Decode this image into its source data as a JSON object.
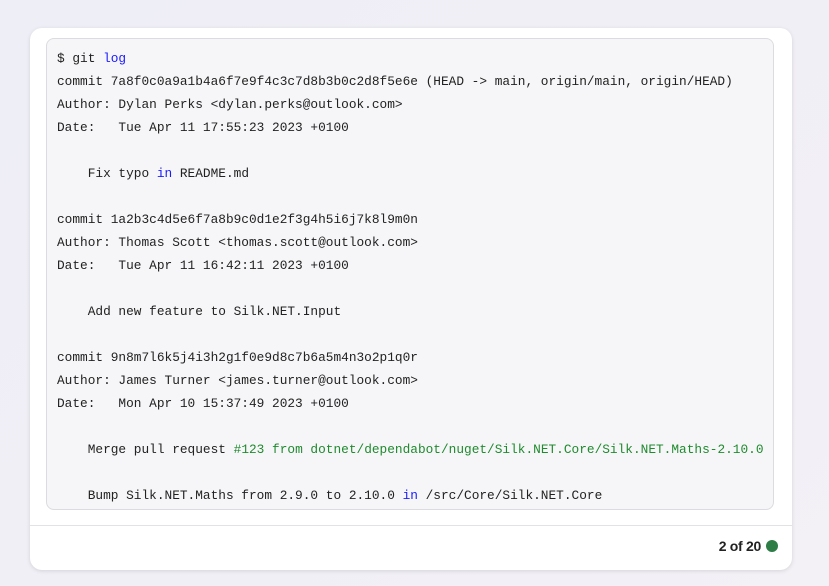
{
  "terminal": {
    "lines": [
      [
        {
          "t": "$ git "
        },
        {
          "t": "log",
          "c": "kw"
        }
      ],
      [
        {
          "t": "commit 7a8f0c0a9a1b4a6f7e9f4c3c7d8b3b0c2d8f5e6e (HEAD -> main, origin/main, origin/HEAD)"
        }
      ],
      [
        {
          "t": "Author: Dylan Perks <dylan.perks@outlook.com>"
        }
      ],
      [
        {
          "t": "Date:   Tue Apr 11 17:55:23 2023 +0100"
        }
      ],
      [
        {
          "t": ""
        }
      ],
      [
        {
          "t": "    Fix typo "
        },
        {
          "t": "in",
          "c": "kw"
        },
        {
          "t": " README.md"
        }
      ],
      [
        {
          "t": ""
        }
      ],
      [
        {
          "t": "commit 1a2b3c4d5e6f7a8b9c0d1e2f3g4h5i6j7k8l9m0n"
        }
      ],
      [
        {
          "t": "Author: Thomas Scott <thomas.scott@outlook.com>"
        }
      ],
      [
        {
          "t": "Date:   Tue Apr 11 16:42:11 2023 +0100"
        }
      ],
      [
        {
          "t": ""
        }
      ],
      [
        {
          "t": "    Add new feature to Silk.NET.Input"
        }
      ],
      [
        {
          "t": ""
        }
      ],
      [
        {
          "t": "commit 9n8m7l6k5j4i3h2g1f0e9d8c7b6a5m4n3o2p1q0r"
        }
      ],
      [
        {
          "t": "Author: James Turner <james.turner@outlook.com>"
        }
      ],
      [
        {
          "t": "Date:   Mon Apr 10 15:37:49 2023 +0100"
        }
      ],
      [
        {
          "t": ""
        }
      ],
      [
        {
          "t": "    Merge pull request "
        },
        {
          "t": "#123 from dotnet/dependabot/nuget/Silk.NET.Core/Silk.NET.Maths-2.10.0",
          "c": "str"
        }
      ],
      [
        {
          "t": ""
        }
      ],
      [
        {
          "t": "    Bump Silk.NET.Maths from 2.9.0 to 2.10.0 "
        },
        {
          "t": "in",
          "c": "kw"
        },
        {
          "t": " /src/Core/Silk.NET.Core"
        }
      ]
    ]
  },
  "footer": {
    "count": "2 of 20",
    "status_color": "#2e7d46"
  }
}
